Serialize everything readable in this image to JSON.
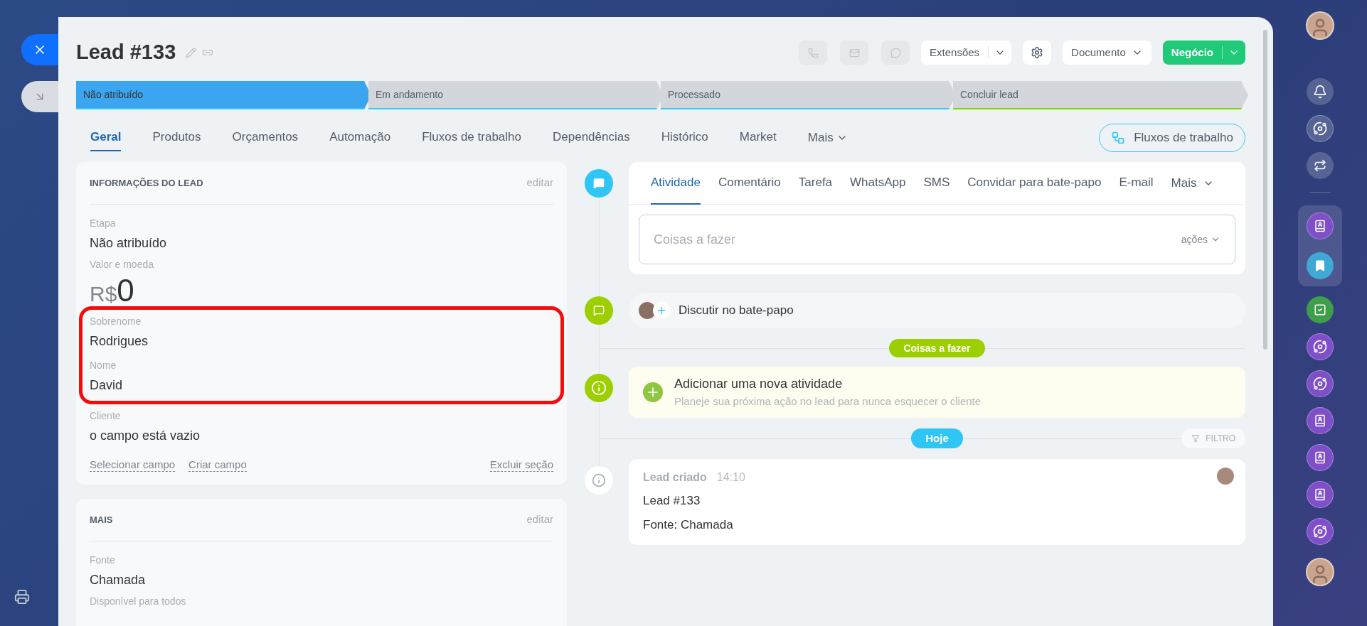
{
  "header": {
    "title": "Lead #133"
  },
  "toolbar": {
    "extensions": "Extensões",
    "document": "Documento",
    "primary": "Negócio"
  },
  "stages": [
    {
      "label": "Não atribuído",
      "selected": true,
      "color": "#3bc8f5"
    },
    {
      "label": "Em andamento",
      "selected": false,
      "color": "#3bc8f5"
    },
    {
      "label": "Processado",
      "selected": false,
      "color": "#3bc8f5"
    },
    {
      "label": "Concluir lead",
      "selected": false,
      "color": "#7bd500"
    }
  ],
  "tabs": [
    {
      "label": "Geral",
      "selected": true
    },
    {
      "label": "Produtos",
      "selected": false
    },
    {
      "label": "Orçamentos",
      "selected": false
    },
    {
      "label": "Automação",
      "selected": false
    },
    {
      "label": "Fluxos de trabalho",
      "selected": false
    },
    {
      "label": "Dependências",
      "selected": false
    },
    {
      "label": "Histórico",
      "selected": false
    },
    {
      "label": "Market",
      "selected": false
    }
  ],
  "tabs_more": "Mais",
  "workflow_button": "Fluxos de trabalho",
  "lead_info": {
    "title": "INFORMAÇÕES DO LEAD",
    "edit": "editar",
    "fields": [
      {
        "kind": "text",
        "label": "Etapa",
        "value": "Não atribuído",
        "highlighted": false
      },
      {
        "kind": "money",
        "label": "Valor e moeda",
        "currency": "R$",
        "value": "0",
        "highlighted": false
      },
      {
        "kind": "text",
        "label": "Sobrenome",
        "value": "Rodrigues",
        "highlighted": true
      },
      {
        "kind": "text",
        "label": "Nome",
        "value": "David",
        "highlighted": true
      },
      {
        "kind": "text",
        "label": "Cliente",
        "value": "o campo está vazio",
        "highlighted": false
      }
    ],
    "links": [
      "Selecionar campo",
      "Criar campo"
    ],
    "delete_section": "Excluir seção"
  },
  "more": {
    "title": "MAIS",
    "edit": "editar",
    "fields": [
      {
        "kind": "text",
        "label": "Fonte",
        "value": "Chamada"
      },
      {
        "kind": "label",
        "label": "Disponível para todos"
      }
    ]
  },
  "activity": {
    "tabs": [
      {
        "label": "Atividade",
        "selected": true
      },
      {
        "label": "Comentário",
        "selected": false
      },
      {
        "label": "Tarefa",
        "selected": false
      },
      {
        "label": "WhatsApp",
        "selected": false
      },
      {
        "label": "SMS",
        "selected": false
      },
      {
        "label": "Convidar para bate-papo",
        "selected": false
      },
      {
        "label": "E-mail",
        "selected": false
      }
    ],
    "more": "Mais",
    "placeholder": "Coisas a fazer",
    "actions": "ações"
  },
  "chat": "Discutir no bate-papo",
  "todo_badge": "Coisas a fazer",
  "add_activity": {
    "title": "Adicionar uma nova atividade",
    "subtitle": "Planeje sua próxima ação no lead para nunca esquecer o cliente"
  },
  "today_badge": "Hoje",
  "filter": "FILTRO",
  "event": {
    "title": "Lead criado",
    "time": "14:10",
    "lines": [
      "Lead #133",
      "Fonte: Chamada"
    ]
  },
  "sidebar": [
    {
      "kind": "avatar"
    },
    {
      "kind": "bell"
    },
    {
      "kind": "copilot"
    },
    {
      "kind": "exchange"
    },
    {
      "kind": "divider"
    },
    {
      "kind": "contact",
      "color": "#7e4fc9",
      "grouped": true
    },
    {
      "kind": "bookmark",
      "color": "#3fa9d6",
      "grouped": true
    },
    {
      "kind": "check",
      "color": "#3f9e4a"
    },
    {
      "kind": "copilot",
      "color": "#7e4fc9"
    },
    {
      "kind": "copilot",
      "color": "#7e4fc9"
    },
    {
      "kind": "contact",
      "color": "#7e4fc9"
    },
    {
      "kind": "contact",
      "color": "#7e4fc9"
    },
    {
      "kind": "contact",
      "color": "#7e4fc9"
    },
    {
      "kind": "copilot",
      "color": "#7e4fc9"
    },
    {
      "kind": "avatar"
    }
  ]
}
